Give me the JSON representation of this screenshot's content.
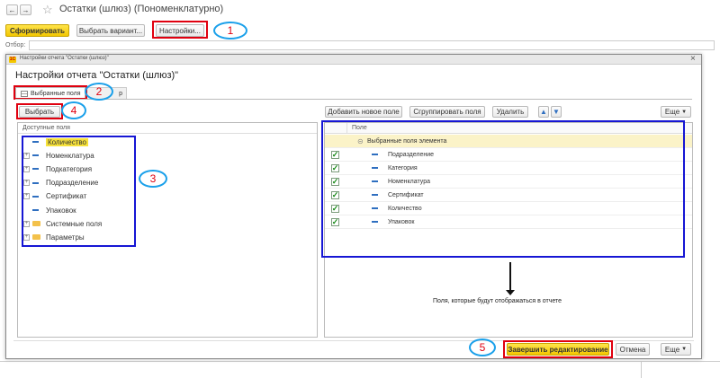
{
  "main_window": {
    "title": "Остатки (шлюз) (Пономенклатурно)",
    "generate_label": "Сформировать",
    "choose_variant_label": "Выбрать вариант...",
    "settings_label": "Настройки...",
    "filter_label": "Отбор:"
  },
  "dialog": {
    "window_title": "Настройки отчета \"Остатки (шлюз)\"",
    "heading": "Настройки отчета \"Остатки (шлюз)\"",
    "tabs": [
      {
        "label": "Выбранные поля"
      },
      {
        "label": "р"
      }
    ],
    "left_panel": {
      "select_label": "Выбрать",
      "header": "Доступные поля",
      "items": [
        {
          "label": "Количество",
          "kind": "field",
          "expandable": false,
          "highlighted": true
        },
        {
          "label": "Номенклатура",
          "kind": "field",
          "expandable": true,
          "highlighted": false
        },
        {
          "label": "Подкатегория",
          "kind": "field",
          "expandable": true,
          "highlighted": false
        },
        {
          "label": "Подразделение",
          "kind": "field",
          "expandable": true,
          "highlighted": false
        },
        {
          "label": "Сертификат",
          "kind": "field",
          "expandable": true,
          "highlighted": false
        },
        {
          "label": "Упаковок",
          "kind": "field",
          "expandable": false,
          "highlighted": false
        },
        {
          "label": "Системные поля",
          "kind": "folder",
          "expandable": true,
          "highlighted": false
        },
        {
          "label": "Параметры",
          "kind": "folder",
          "expandable": true,
          "highlighted": false
        }
      ]
    },
    "right_panel": {
      "add_field_label": "Добавить новое поле",
      "group_fields_label": "Сгруппировать поля",
      "delete_label": "Удалить",
      "more_label": "Еще",
      "column_header": "Поле",
      "group_label": "Выбранные поля элемента",
      "items": [
        {
          "label": "Подразделение",
          "checked": true
        },
        {
          "label": "Категория",
          "checked": true
        },
        {
          "label": "Номенклатура",
          "checked": true
        },
        {
          "label": "Сертификат",
          "checked": true
        },
        {
          "label": "Количество",
          "checked": true
        },
        {
          "label": "Упаковок",
          "checked": true
        }
      ],
      "annotation": "Поля, которые будут отображаться в отчете"
    },
    "footer": {
      "finish_label": "Завершить редактирование",
      "cancel_label": "Отмена",
      "more_label": "Еще"
    }
  },
  "callouts": [
    "1",
    "2",
    "3",
    "4",
    "5"
  ],
  "colors": {
    "highlight_red": "#e0000f",
    "highlight_blue": "#1616d4",
    "callout_ring": "#1aa0ea",
    "accent_yellow": "#f3c700"
  }
}
